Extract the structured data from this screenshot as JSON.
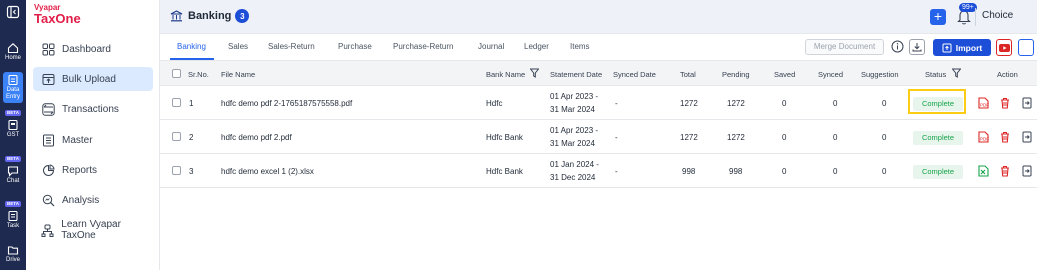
{
  "rail": {
    "items": [
      {
        "label": "Home",
        "beta": ""
      },
      {
        "label": "Data\nEntry",
        "beta": "BETA"
      },
      {
        "label": "GST",
        "beta": "BETA"
      },
      {
        "label": "Chat",
        "beta": "BETA"
      },
      {
        "label": "Task",
        "beta": ""
      },
      {
        "label": "Drive",
        "beta": ""
      }
    ],
    "beta_label": "BETA"
  },
  "brand": {
    "line1": "Vyapar",
    "line2": "TaxOne"
  },
  "sidebar": {
    "items": [
      {
        "label": "Dashboard",
        "icon": "grid-icon"
      },
      {
        "label": "Bulk Upload",
        "icon": "upload-icon"
      },
      {
        "label": "Transactions",
        "icon": "transactions-icon"
      },
      {
        "label": "Master",
        "icon": "master-icon"
      },
      {
        "label": "Reports",
        "icon": "reports-icon"
      },
      {
        "label": "Analysis",
        "icon": "analysis-icon"
      },
      {
        "label": "Learn Vyapar TaxOne",
        "icon": "learn-icon"
      }
    ]
  },
  "header": {
    "title": "Banking",
    "count": "3",
    "notifications": "99+",
    "company": "Choice"
  },
  "tabs": [
    "Banking",
    "Sales",
    "Sales-Return",
    "Purchase",
    "Purchase-Return",
    "Journal",
    "Ledger",
    "Items"
  ],
  "toolbar": {
    "merge": "Merge Document",
    "import": "Import"
  },
  "table": {
    "columns": [
      "Sr.No.",
      "File Name",
      "Bank Name",
      "Statement Date",
      "Synced Date",
      "Total",
      "Pending",
      "Saved",
      "Synced",
      "Suggestion",
      "Status",
      "Action"
    ],
    "rows": [
      {
        "srno": "1",
        "file": "hdfc demo pdf 2-1765187575558.pdf",
        "bank": "Hdfc",
        "date1": "01 Apr 2023 -",
        "date2": "31 Mar 2024",
        "synced_date": "-",
        "total": "1272",
        "pending": "1272",
        "saved": "0",
        "synced": "0",
        "suggestion": "0",
        "status": "Complete",
        "type": "pdf"
      },
      {
        "srno": "2",
        "file": "hdfc demo pdf 2.pdf",
        "bank": "Hdfc Bank",
        "date1": "01 Apr 2023 -",
        "date2": "31 Mar 2024",
        "synced_date": "-",
        "total": "1272",
        "pending": "1272",
        "saved": "0",
        "synced": "0",
        "suggestion": "0",
        "status": "Complete",
        "type": "pdf"
      },
      {
        "srno": "3",
        "file": "hdfc demo excel 1 (2).xlsx",
        "bank": "Hdfc Bank",
        "date1": "01 Jan 2024 -",
        "date2": "31 Dec 2024",
        "synced_date": "-",
        "total": "998",
        "pending": "998",
        "saved": "0",
        "synced": "0",
        "suggestion": "0",
        "status": "Complete",
        "type": "excel"
      }
    ]
  },
  "colors": {
    "accent": "#2563eb",
    "rail": "#1e2a4f",
    "brand": "#e11d48",
    "complete": "#16a34a",
    "highlight": "#facc15"
  }
}
